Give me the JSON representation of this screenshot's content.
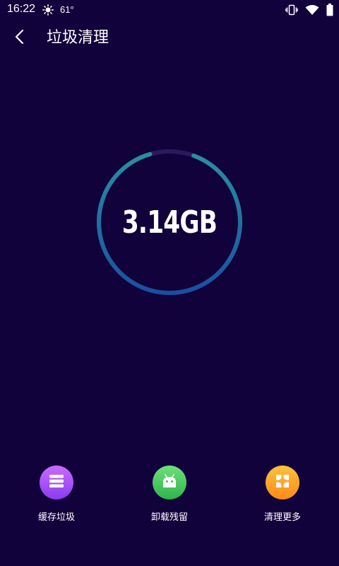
{
  "status_bar": {
    "time": "16:22",
    "weather_icon": "sun-icon",
    "temperature": "61°",
    "icons": [
      "vibrate-icon",
      "wifi-icon",
      "battery-icon"
    ]
  },
  "header": {
    "back_icon": "chevron-left-icon",
    "title": "垃圾清理"
  },
  "gauge": {
    "value": "3.14GB",
    "progress": 0.9,
    "colors": {
      "track": "#2a1a5c",
      "start": "#2a8fa0",
      "end": "#1a4fa0"
    }
  },
  "actions": [
    {
      "label": "缓存垃圾",
      "icon": "list-icon",
      "color_start": "#c86cff",
      "color_end": "#8a3cf0"
    },
    {
      "label": "卸载残留",
      "icon": "android-icon",
      "color_start": "#6ee07a",
      "color_end": "#2fb44a"
    },
    {
      "label": "清理更多",
      "icon": "grid-icon",
      "color_start": "#ffc23a",
      "color_end": "#ff8a1a"
    }
  ],
  "colors": {
    "background": "#12023c",
    "text": "#ffffff"
  }
}
